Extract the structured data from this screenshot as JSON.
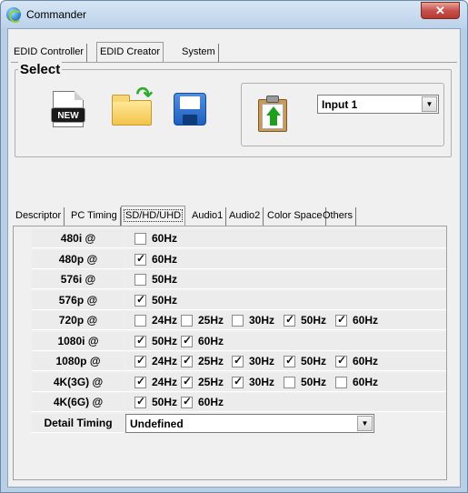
{
  "window": {
    "title": "Commander",
    "close_glyph": "✕"
  },
  "main_tabs": [
    {
      "label": "EDID Controller",
      "active": false
    },
    {
      "label": "EDID Creator",
      "active": true
    },
    {
      "label": "System",
      "active": false
    }
  ],
  "select_group": {
    "title": "Select",
    "buttons": [
      {
        "name": "new",
        "icon": "new-file-icon",
        "badge": "NEW"
      },
      {
        "name": "open",
        "icon": "open-folder-icon"
      },
      {
        "name": "save",
        "icon": "floppy-disk-icon"
      },
      {
        "name": "upload",
        "icon": "clipboard-upload-icon"
      }
    ],
    "input_select": {
      "value": "Input 1"
    }
  },
  "sub_tabs": [
    {
      "label": "Descriptor",
      "active": false
    },
    {
      "label": "PC Timing",
      "active": false
    },
    {
      "label": "SD/HD/UHD",
      "active": true
    },
    {
      "label": "Audio1",
      "active": false
    },
    {
      "label": "Audio2",
      "active": false
    },
    {
      "label": "Color Space",
      "active": false
    },
    {
      "label": "Others",
      "active": false
    }
  ],
  "timings": [
    {
      "label": "480i @",
      "options": [
        {
          "text": "60Hz",
          "checked": false
        }
      ]
    },
    {
      "label": "480p @",
      "options": [
        {
          "text": "60Hz",
          "checked": true
        }
      ]
    },
    {
      "label": "576i @",
      "options": [
        {
          "text": "50Hz",
          "checked": false
        }
      ]
    },
    {
      "label": "576p @",
      "options": [
        {
          "text": "50Hz",
          "checked": true
        }
      ]
    },
    {
      "label": "720p @",
      "options": [
        {
          "text": "24Hz",
          "checked": false
        },
        {
          "text": "25Hz",
          "checked": false
        },
        {
          "text": "30Hz",
          "checked": false
        },
        {
          "text": "50Hz",
          "checked": true
        },
        {
          "text": "60Hz",
          "checked": true
        }
      ]
    },
    {
      "label": "1080i @",
      "options": [
        {
          "text": "50Hz",
          "checked": true
        },
        {
          "text": "60Hz",
          "checked": true
        }
      ]
    },
    {
      "label": "1080p @",
      "options": [
        {
          "text": "24Hz",
          "checked": true
        },
        {
          "text": "25Hz",
          "checked": true
        },
        {
          "text": "30Hz",
          "checked": true
        },
        {
          "text": "50Hz",
          "checked": true
        },
        {
          "text": "60Hz",
          "checked": true
        }
      ]
    },
    {
      "label": "4K(3G) @",
      "options": [
        {
          "text": "24Hz",
          "checked": true
        },
        {
          "text": "25Hz",
          "checked": true
        },
        {
          "text": "30Hz",
          "checked": true
        },
        {
          "text": "50Hz",
          "checked": false
        },
        {
          "text": "60Hz",
          "checked": false
        }
      ]
    },
    {
      "label": "4K(6G) @",
      "options": [
        {
          "text": "50Hz",
          "checked": true
        },
        {
          "text": "60Hz",
          "checked": true
        }
      ]
    }
  ],
  "detail_timing": {
    "label": "Detail Timing",
    "value": "Undefined"
  }
}
